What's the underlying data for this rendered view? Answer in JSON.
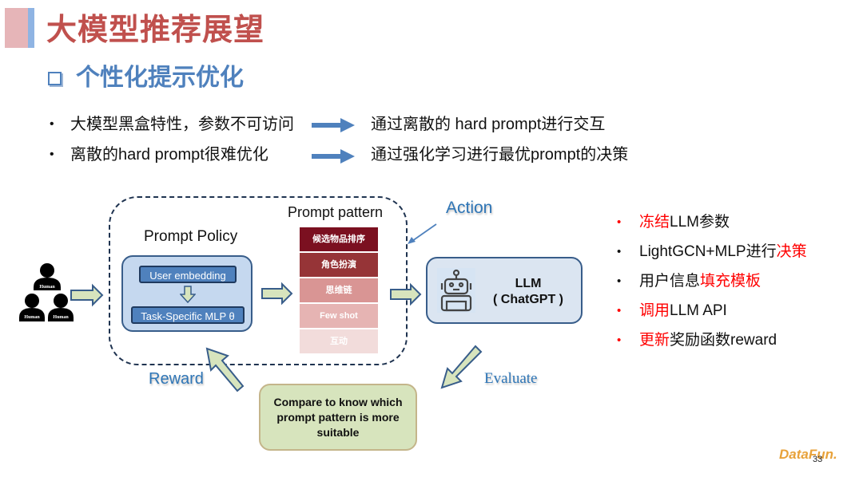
{
  "header": {
    "title": "大模型推荐展望",
    "subtitle": "个性化提示优化"
  },
  "top_bullets": [
    {
      "left": "大模型黑盒特性，参数不可访问",
      "right": "通过离散的 hard prompt进行交互"
    },
    {
      "left": "离散的hard prompt很难优化",
      "right": "通过强化学习进行最优prompt的决策"
    }
  ],
  "diagram": {
    "humans": [
      "Human",
      "Human",
      "Human"
    ],
    "prompt_policy": {
      "label": "Prompt Policy",
      "user_embedding": "User embedding",
      "mlp": "Task-Specific MLP θ"
    },
    "prompt_pattern": {
      "label": "Prompt pattern",
      "items": [
        {
          "text": "候选物品排序",
          "color": "#7b1020"
        },
        {
          "text": "角色扮演",
          "color": "#963437"
        },
        {
          "text": "思维链",
          "color": "#d99594"
        },
        {
          "text": "Few shot",
          "color": "#e6b4b3"
        },
        {
          "text": "互动",
          "color": "#f2dcdb"
        }
      ]
    },
    "action_label": "Action",
    "llm": {
      "line1": "LLM",
      "line2": "( ChatGPT )"
    },
    "reward_label": "Reward",
    "evaluate_label": "Evaluate",
    "compare_text": "Compare to know which prompt pattern is more suitable"
  },
  "right_list": [
    {
      "parts": [
        {
          "text": "冻结",
          "red": true
        },
        {
          "text": "LLM参数",
          "red": false
        }
      ],
      "dot_red": true
    },
    {
      "parts": [
        {
          "text": "LightGCN+MLP进行",
          "red": false
        },
        {
          "text": "决策",
          "red": true
        }
      ],
      "dot_red": false
    },
    {
      "parts": [
        {
          "text": "用户信息",
          "red": false
        },
        {
          "text": "填充模板",
          "red": true
        }
      ],
      "dot_red": false
    },
    {
      "parts": [
        {
          "text": "调用",
          "red": true
        },
        {
          "text": "LLM API",
          "red": false
        }
      ],
      "dot_red": true
    },
    {
      "parts": [
        {
          "text": "更新",
          "red": true
        },
        {
          "text": "奖励函数reward",
          "red": false
        }
      ],
      "dot_red": true
    }
  ],
  "footer": {
    "logo": "DataFun.",
    "page_number": "33"
  },
  "colors": {
    "title_red": "#c0504d",
    "subtitle_blue": "#4f81bd",
    "accent_red": "#ff0000",
    "label_blue": "#2e75b6",
    "arrow_fill": "#d7e4bd",
    "arrow_stroke": "#385d8a"
  }
}
